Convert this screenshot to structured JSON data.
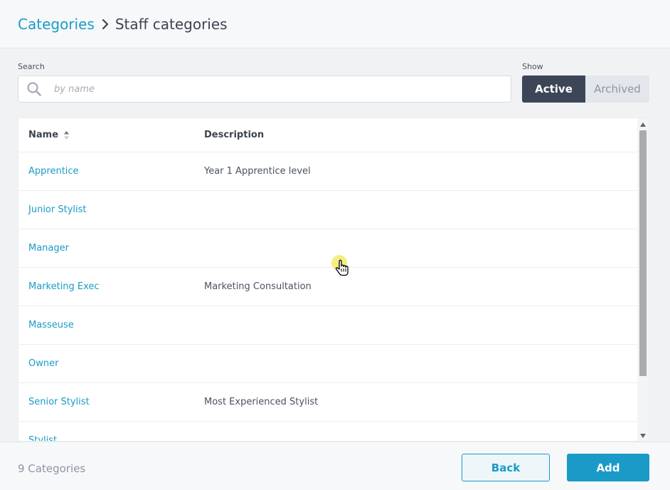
{
  "breadcrumb": {
    "parent": "Categories",
    "current": "Staff categories"
  },
  "search": {
    "label": "Search",
    "placeholder": "by name",
    "value": ""
  },
  "show": {
    "label": "Show",
    "options": [
      "Active",
      "Archived"
    ],
    "selected": "Active"
  },
  "table": {
    "columns": {
      "name": "Name",
      "description": "Description"
    },
    "sort": {
      "column": "Name",
      "direction": "ascending"
    },
    "rows": [
      {
        "name": "Apprentice",
        "description": "Year 1 Apprentice level"
      },
      {
        "name": "Junior Stylist",
        "description": ""
      },
      {
        "name": "Manager",
        "description": ""
      },
      {
        "name": "Marketing Exec",
        "description": "Marketing Consultation"
      },
      {
        "name": "Masseuse",
        "description": ""
      },
      {
        "name": "Owner",
        "description": ""
      },
      {
        "name": "Senior Stylist",
        "description": "Most Experienced Stylist"
      },
      {
        "name": "Stylist",
        "description": ""
      }
    ]
  },
  "footer": {
    "count_text": "9 Categories",
    "back_label": "Back",
    "add_label": "Add"
  },
  "colors": {
    "accent": "#1a9bc7",
    "toggle_active_bg": "#3d4657",
    "text": "#3d4451",
    "muted": "#8e95a1"
  },
  "icons": {
    "breadcrumb_separator": "chevron-right-icon",
    "search": "search-icon",
    "sort": "sort-icon",
    "pointer": "hand-pointer-icon"
  }
}
